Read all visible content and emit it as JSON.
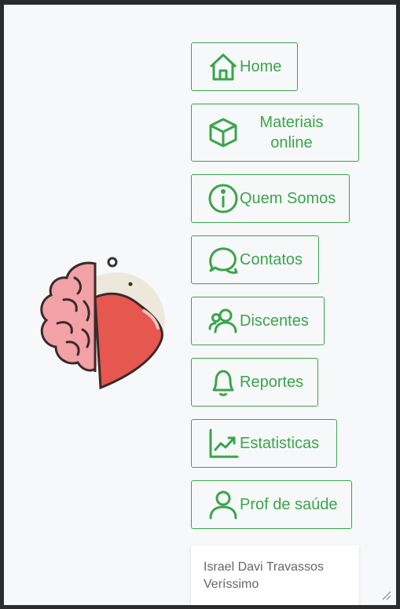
{
  "nav": {
    "home": "Home",
    "materiais": "Materiais online",
    "quem_somos": "Quem Somos",
    "contatos": "Contatos",
    "discentes": "Discentes",
    "reportes": "Reportes",
    "estatisticas": "Estatisticas",
    "prof_saude": "Prof de saúde"
  },
  "user": {
    "name": "Israel Davi Travassos Veríssimo"
  },
  "colors": {
    "accent": "#3aa54a",
    "background": "#f7f8fa",
    "heart": "#e5574f",
    "brain": "#f2a1a6"
  },
  "icons": [
    "home-icon",
    "box-icon",
    "info-icon",
    "chat-icon",
    "users-icon",
    "bell-icon",
    "chart-icon",
    "user-icon"
  ]
}
